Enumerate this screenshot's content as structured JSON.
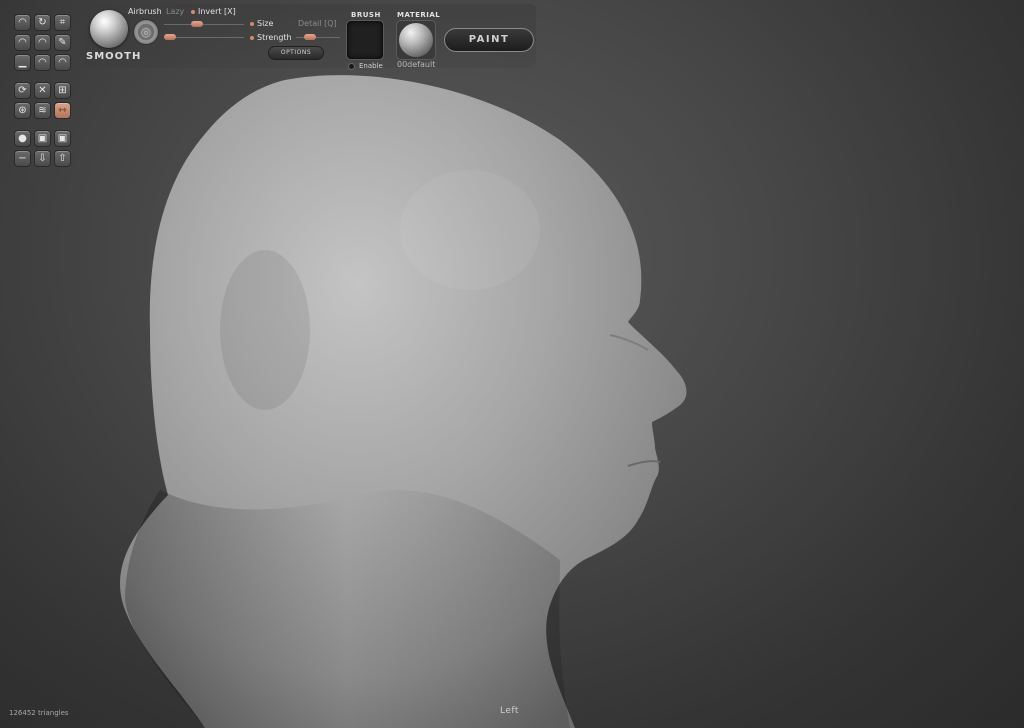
{
  "toolbox": {
    "rows": [
      [
        {
          "icon": "draw-tool-icon",
          "glyph": "◠"
        },
        {
          "icon": "rotate-tool-icon",
          "glyph": "↻"
        },
        {
          "icon": "crop-tool-icon",
          "glyph": "⌗"
        }
      ],
      [
        {
          "icon": "clay-brush-icon",
          "glyph": "◠"
        },
        {
          "icon": "inflate-brush-icon",
          "glyph": "◠"
        },
        {
          "icon": "pinch-brush-icon",
          "glyph": "✎"
        }
      ],
      [
        {
          "icon": "flatten-brush-icon",
          "glyph": "▁"
        },
        {
          "icon": "smooth-brush-icon",
          "glyph": "◠"
        },
        {
          "icon": "grab-brush-icon",
          "glyph": "◠"
        }
      ],
      [],
      [
        {
          "icon": "refresh-icon",
          "glyph": "⟳"
        },
        {
          "icon": "symmetry-x-icon",
          "glyph": "✕"
        },
        {
          "icon": "grid-icon",
          "glyph": "⊞"
        }
      ],
      [
        {
          "icon": "wireframe-icon",
          "glyph": "⊛"
        },
        {
          "icon": "wave-icon",
          "glyph": "≋"
        },
        {
          "icon": "mirror-icon",
          "glyph": "⇿",
          "active": true
        }
      ],
      [],
      [
        {
          "icon": "sphere-primitive-icon",
          "glyph": "●"
        },
        {
          "icon": "camera-icon",
          "glyph": "▣"
        },
        {
          "icon": "video-icon",
          "glyph": "▣"
        }
      ],
      [
        {
          "icon": "minus-icon",
          "glyph": "−"
        },
        {
          "icon": "import-icon",
          "glyph": "⇩"
        },
        {
          "icon": "export-icon",
          "glyph": "⇧"
        }
      ]
    ]
  },
  "brush": {
    "name": "SMOOTH",
    "airbrush_label": "Airbrush",
    "lazy_label": "Lazy",
    "invert_label": "Invert [X]",
    "size_label": "Size",
    "detail_label": "Detail [Q]",
    "strength_label": "Strength",
    "options_label": "OPTIONS"
  },
  "brush_panel": {
    "title": "BRUSH",
    "enable_label": "Enable"
  },
  "material_panel": {
    "title": "MATERIAL",
    "name": "00default"
  },
  "paint_button": {
    "label": "PAINT"
  },
  "status": {
    "triangles": "126452 triangles",
    "view": "Left"
  },
  "colors": {
    "accent": "#d88a68",
    "mesh": "#a9a9a9",
    "background": "#3c3c3c"
  }
}
